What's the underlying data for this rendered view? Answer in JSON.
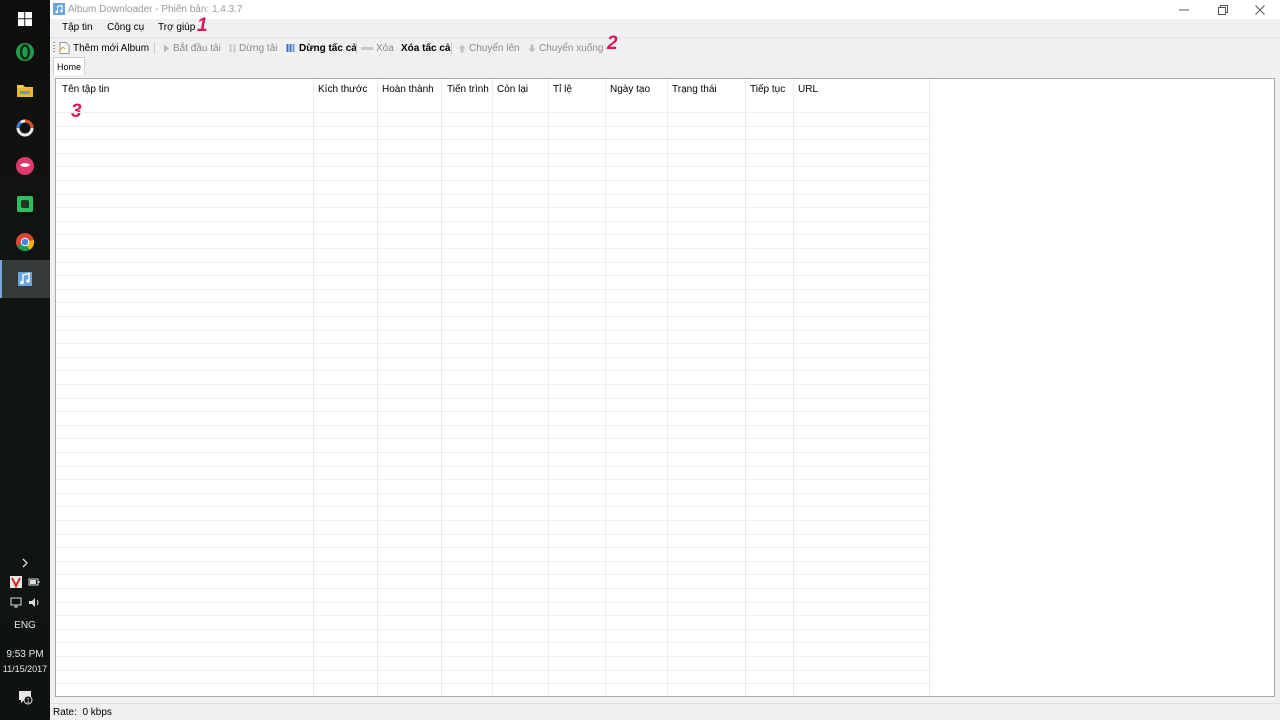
{
  "window": {
    "title": "Album Downloader - Phiên bản: 1.4.3.7"
  },
  "menu": {
    "items": [
      "Tập tin",
      "Công cụ",
      "Trợ giúp"
    ]
  },
  "toolbar": {
    "add_album": "Thêm mới Album",
    "start": "Bắt đầu tải",
    "stop": "Dừng tải",
    "stop_all": "Dừng tấc cả",
    "delete": "Xóa",
    "delete_all": "Xóa tấc cả",
    "move_up": "Chuyển lên",
    "move_down": "Chuyển xuống"
  },
  "tabs": {
    "home": "Home"
  },
  "grid": {
    "columns": [
      "Tên tập tin",
      "Kích thước",
      "Hoàn thành",
      "Tiến trình",
      "Còn lại",
      "Tỉ lệ",
      "Ngày tạo",
      "Trạng thái",
      "Tiếp tục",
      "URL"
    ],
    "rows": []
  },
  "markers": [
    "1",
    "2",
    "3"
  ],
  "status": {
    "rate_label": "Rate:",
    "rate_value": "0 kbps"
  },
  "taskbar": {
    "language": "ENG",
    "time": "9:53 PM",
    "date": "11/15/2017",
    "notification_count": "1"
  },
  "colors": {
    "marker": "#d6195e",
    "taskbar": "#101410"
  }
}
